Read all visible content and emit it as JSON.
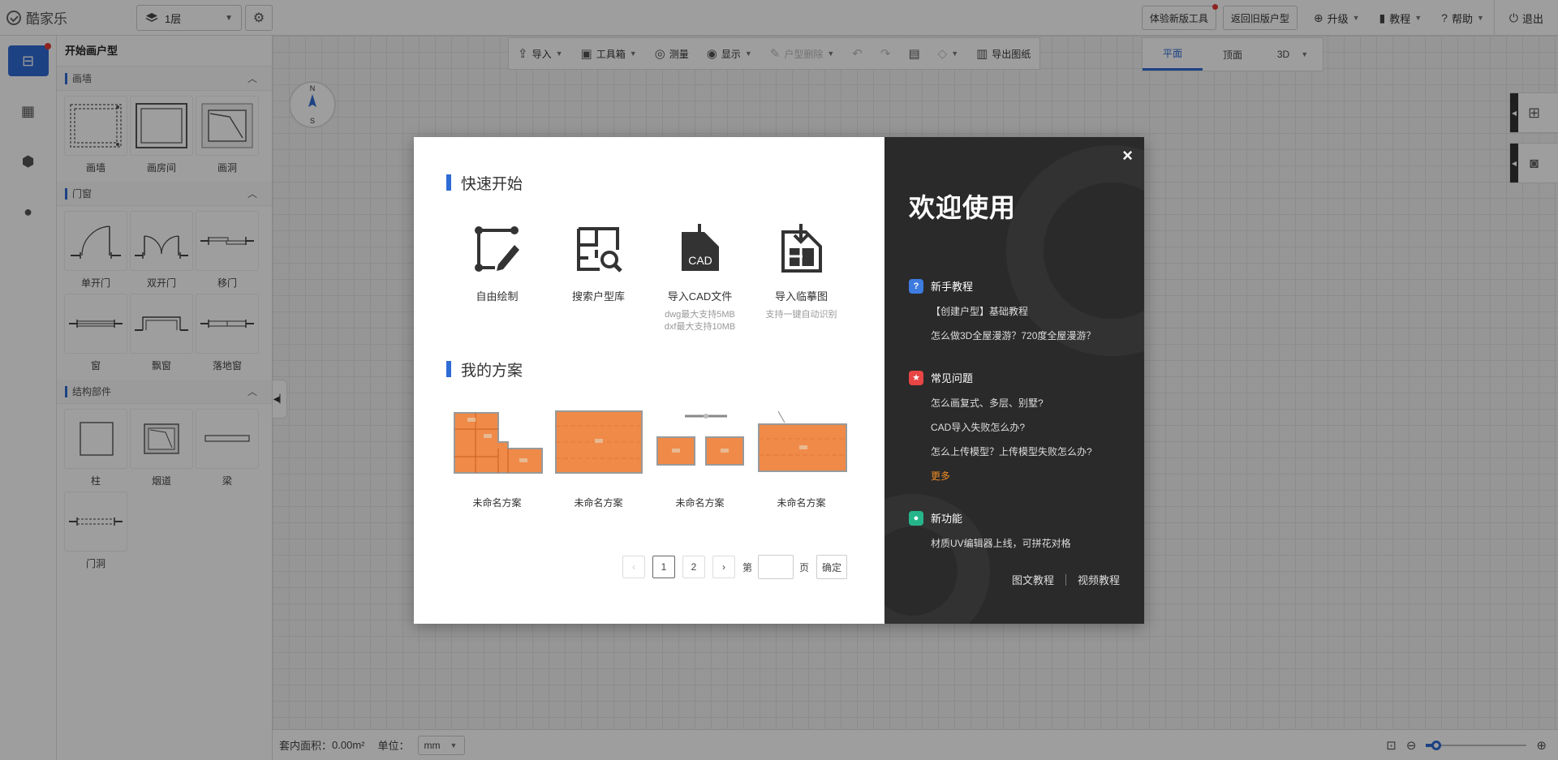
{
  "topbar": {
    "logo": "酷家乐",
    "floor": "1层",
    "try_new_tool": "体验新版工具",
    "back_old": "返回旧版户型",
    "upgrade": "升级",
    "tutorial": "教程",
    "help": "帮助",
    "logout": "退出"
  },
  "panel": {
    "title": "开始画户型",
    "sections": [
      {
        "title": "画墙",
        "items": [
          "画墙",
          "画房间",
          "画洞"
        ]
      },
      {
        "title": "门窗",
        "items": [
          "单开门",
          "双开门",
          "移门",
          "窗",
          "飘窗",
          "落地窗"
        ]
      },
      {
        "title": "结构部件",
        "items": [
          "柱",
          "烟道",
          "梁",
          "门洞"
        ]
      }
    ]
  },
  "compass": {
    "n": "N",
    "s": "S"
  },
  "toolbar": {
    "import": "导入",
    "toolbox": "工具箱",
    "measure": "测量",
    "display": "显示",
    "house_delete": "户型删除",
    "export": "导出图纸"
  },
  "view_tabs": {
    "plan": "平面",
    "top": "顶面",
    "three_d": "3D"
  },
  "status": {
    "area_label": "套内面积：",
    "area_value": "0.00m²",
    "unit_label": "单位：",
    "unit_value": "mm",
    "zoom_level": 0.1
  },
  "modal": {
    "quick_start_title": "快速开始",
    "quick_items": [
      {
        "label": "自由绘制",
        "sub1": "",
        "sub2": ""
      },
      {
        "label": "搜索户型库",
        "sub1": "",
        "sub2": ""
      },
      {
        "label": "导入CAD文件",
        "sub1": "dwg最大支持5MB",
        "sub2": "dxf最大支持10MB",
        "icon_text": "CAD"
      },
      {
        "label": "导入临摹图",
        "sub1": "支持一键自动识别",
        "sub2": ""
      }
    ],
    "my_plans_title": "我的方案",
    "plans": [
      "未命名方案",
      "未命名方案",
      "未命名方案",
      "未命名方案"
    ],
    "pager": {
      "prev": "‹",
      "pages": [
        "1",
        "2"
      ],
      "next": "›",
      "page_prefix": "第",
      "page_suffix": "页",
      "confirm": "确定"
    },
    "close": "×",
    "welcome": "欢迎使用",
    "groups": [
      {
        "title": "新手教程",
        "color": "#3d7be0",
        "icon": "?",
        "links": [
          "【创建户型】基础教程",
          "怎么做3D全屋漫游？720度全屋漫游？"
        ]
      },
      {
        "title": "常见问题",
        "color": "#e84545",
        "icon": "★",
        "links": [
          "怎么画复式、多层、别墅?",
          "CAD导入失败怎么办?",
          "怎么上传模型？上传模型失败怎么办?"
        ],
        "more": "更多"
      },
      {
        "title": "新功能",
        "color": "#26b58a",
        "icon": "●",
        "links": [
          "材质UV编辑器上线，可拼花对格"
        ]
      }
    ],
    "bottom_links": {
      "graphic": "图文教程",
      "video": "视频教程"
    }
  }
}
